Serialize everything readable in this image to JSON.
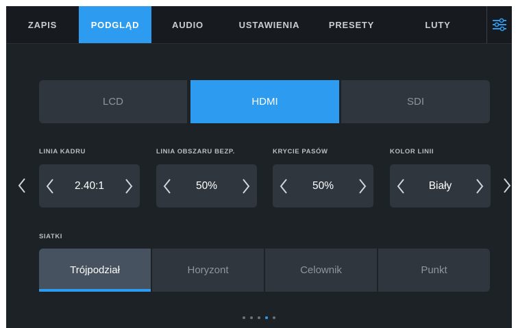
{
  "tabs": [
    {
      "label": "ZAPIS"
    },
    {
      "label": "PODGLĄD"
    },
    {
      "label": "AUDIO"
    },
    {
      "label": "USTAWIENIA"
    },
    {
      "label": "PRESETY"
    },
    {
      "label": "LUTY"
    }
  ],
  "active_tab": "PODGLĄD",
  "outputs": [
    {
      "label": "LCD"
    },
    {
      "label": "HDMI"
    },
    {
      "label": "SDI"
    }
  ],
  "active_output": "HDMI",
  "settings": [
    {
      "label": "LINIA KADRU",
      "value": "2.40:1"
    },
    {
      "label": "LINIA OBSZARU BEZP.",
      "value": "50%"
    },
    {
      "label": "KRYCIE PASÓW",
      "value": "50%"
    },
    {
      "label": "KOLOR LINII",
      "value": "Biały"
    }
  ],
  "grids": {
    "label": "SIATKI",
    "options": [
      {
        "label": "Trójpodział"
      },
      {
        "label": "Horyzont"
      },
      {
        "label": "Celownik"
      },
      {
        "label": "Punkt"
      }
    ],
    "selected": "Trójpodział"
  },
  "pagination": {
    "pages": 5,
    "current": 4
  },
  "colors": {
    "accent": "#2d9cf0",
    "background": "#1d2227",
    "button": "#2f363e"
  }
}
